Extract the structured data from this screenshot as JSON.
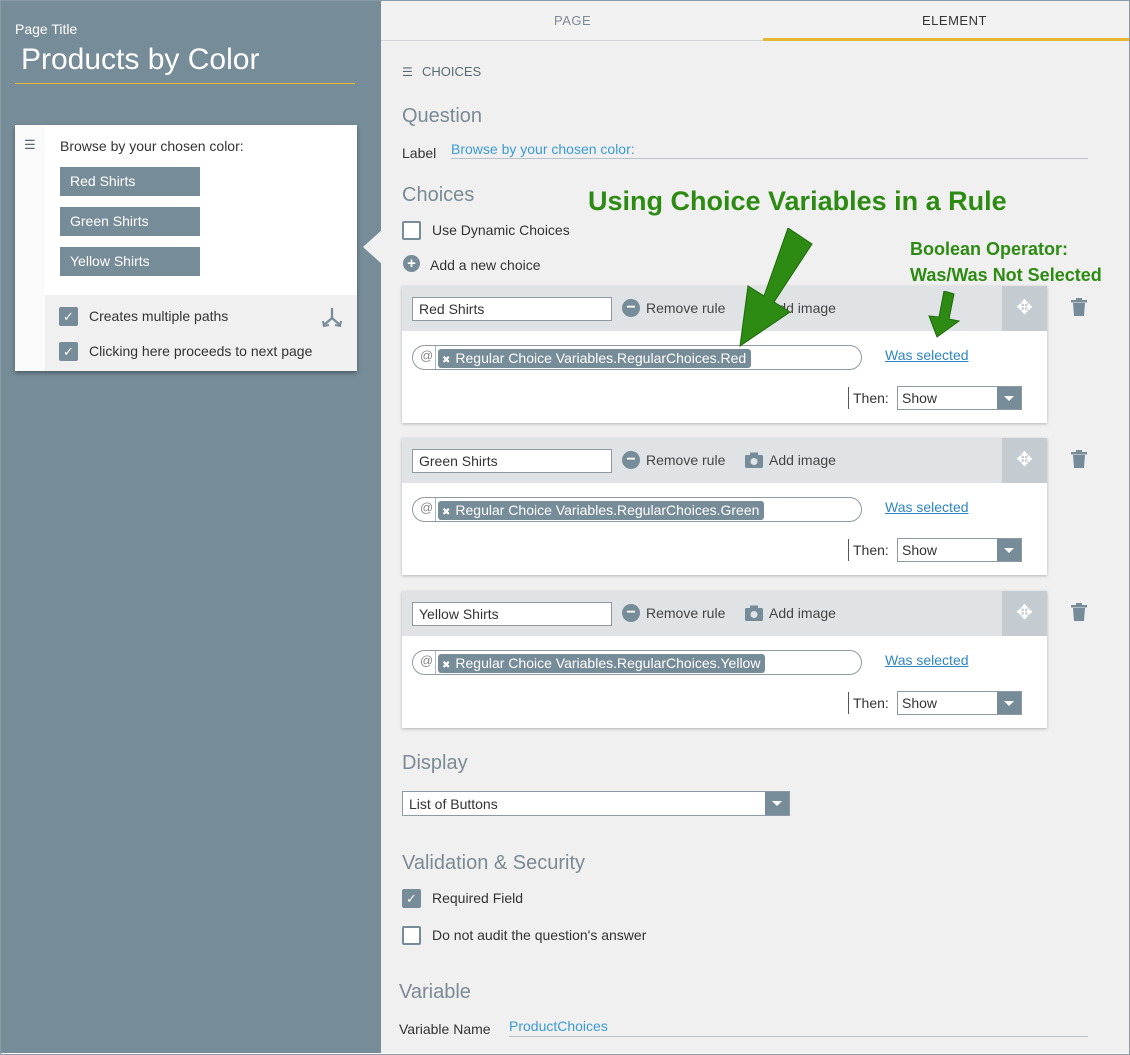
{
  "left_panel": {
    "page_title_label": "Page Title",
    "page_title": "Products by Color",
    "question_text": "Browse by your chosen color:",
    "choices": [
      "Red Shirts",
      "Green Shirts",
      "Yellow Shirts"
    ],
    "options": [
      {
        "label": "Creates multiple paths",
        "checked": true
      },
      {
        "label": "Clicking here proceeds to next page",
        "checked": true
      }
    ]
  },
  "tabs": {
    "page": "PAGE",
    "element": "ELEMENT",
    "active": "ELEMENT"
  },
  "header": {
    "section_label": "CHOICES"
  },
  "question": {
    "title": "Question",
    "label_label": "Label",
    "label_value": "Browse by your chosen color:"
  },
  "choices_section": {
    "title": "Choices",
    "use_dynamic": "Use Dynamic Choices",
    "add_choice": "Add a new choice"
  },
  "rules": [
    {
      "name": "Red Shirts",
      "remove": "Remove rule",
      "add_image": "Add image",
      "variable": "Regular Choice Variables.RegularChoices.Red",
      "operator": "Was selected",
      "then_label": "Then:",
      "then_value": "Show"
    },
    {
      "name": "Green Shirts",
      "remove": "Remove rule",
      "add_image": "Add image",
      "variable": "Regular Choice Variables.RegularChoices.Green",
      "operator": "Was selected",
      "then_label": "Then:",
      "then_value": "Show"
    },
    {
      "name": "Yellow Shirts",
      "remove": "Remove rule",
      "add_image": "Add image",
      "variable": "Regular Choice Variables.RegularChoices.Yellow",
      "operator": "Was selected",
      "then_label": "Then:",
      "then_value": "Show"
    }
  ],
  "display": {
    "title": "Display",
    "value": "List of Buttons"
  },
  "validation": {
    "title": "Validation & Security",
    "required": {
      "label": "Required Field",
      "checked": true
    },
    "no_audit": {
      "label": "Do not audit the question's answer",
      "checked": false
    }
  },
  "variable": {
    "title": "Variable",
    "name_label": "Variable Name",
    "name_value": "ProductChoices"
  },
  "annotations": {
    "title": "Using Choice Variables in a Rule",
    "bool_line1": "Boolean Operator:",
    "bool_line2": "Was/Was Not Selected"
  },
  "colors": {
    "accent": "#e8b833",
    "panel": "#778c99",
    "annotation": "#2d8a12",
    "link": "#2e86c1"
  }
}
